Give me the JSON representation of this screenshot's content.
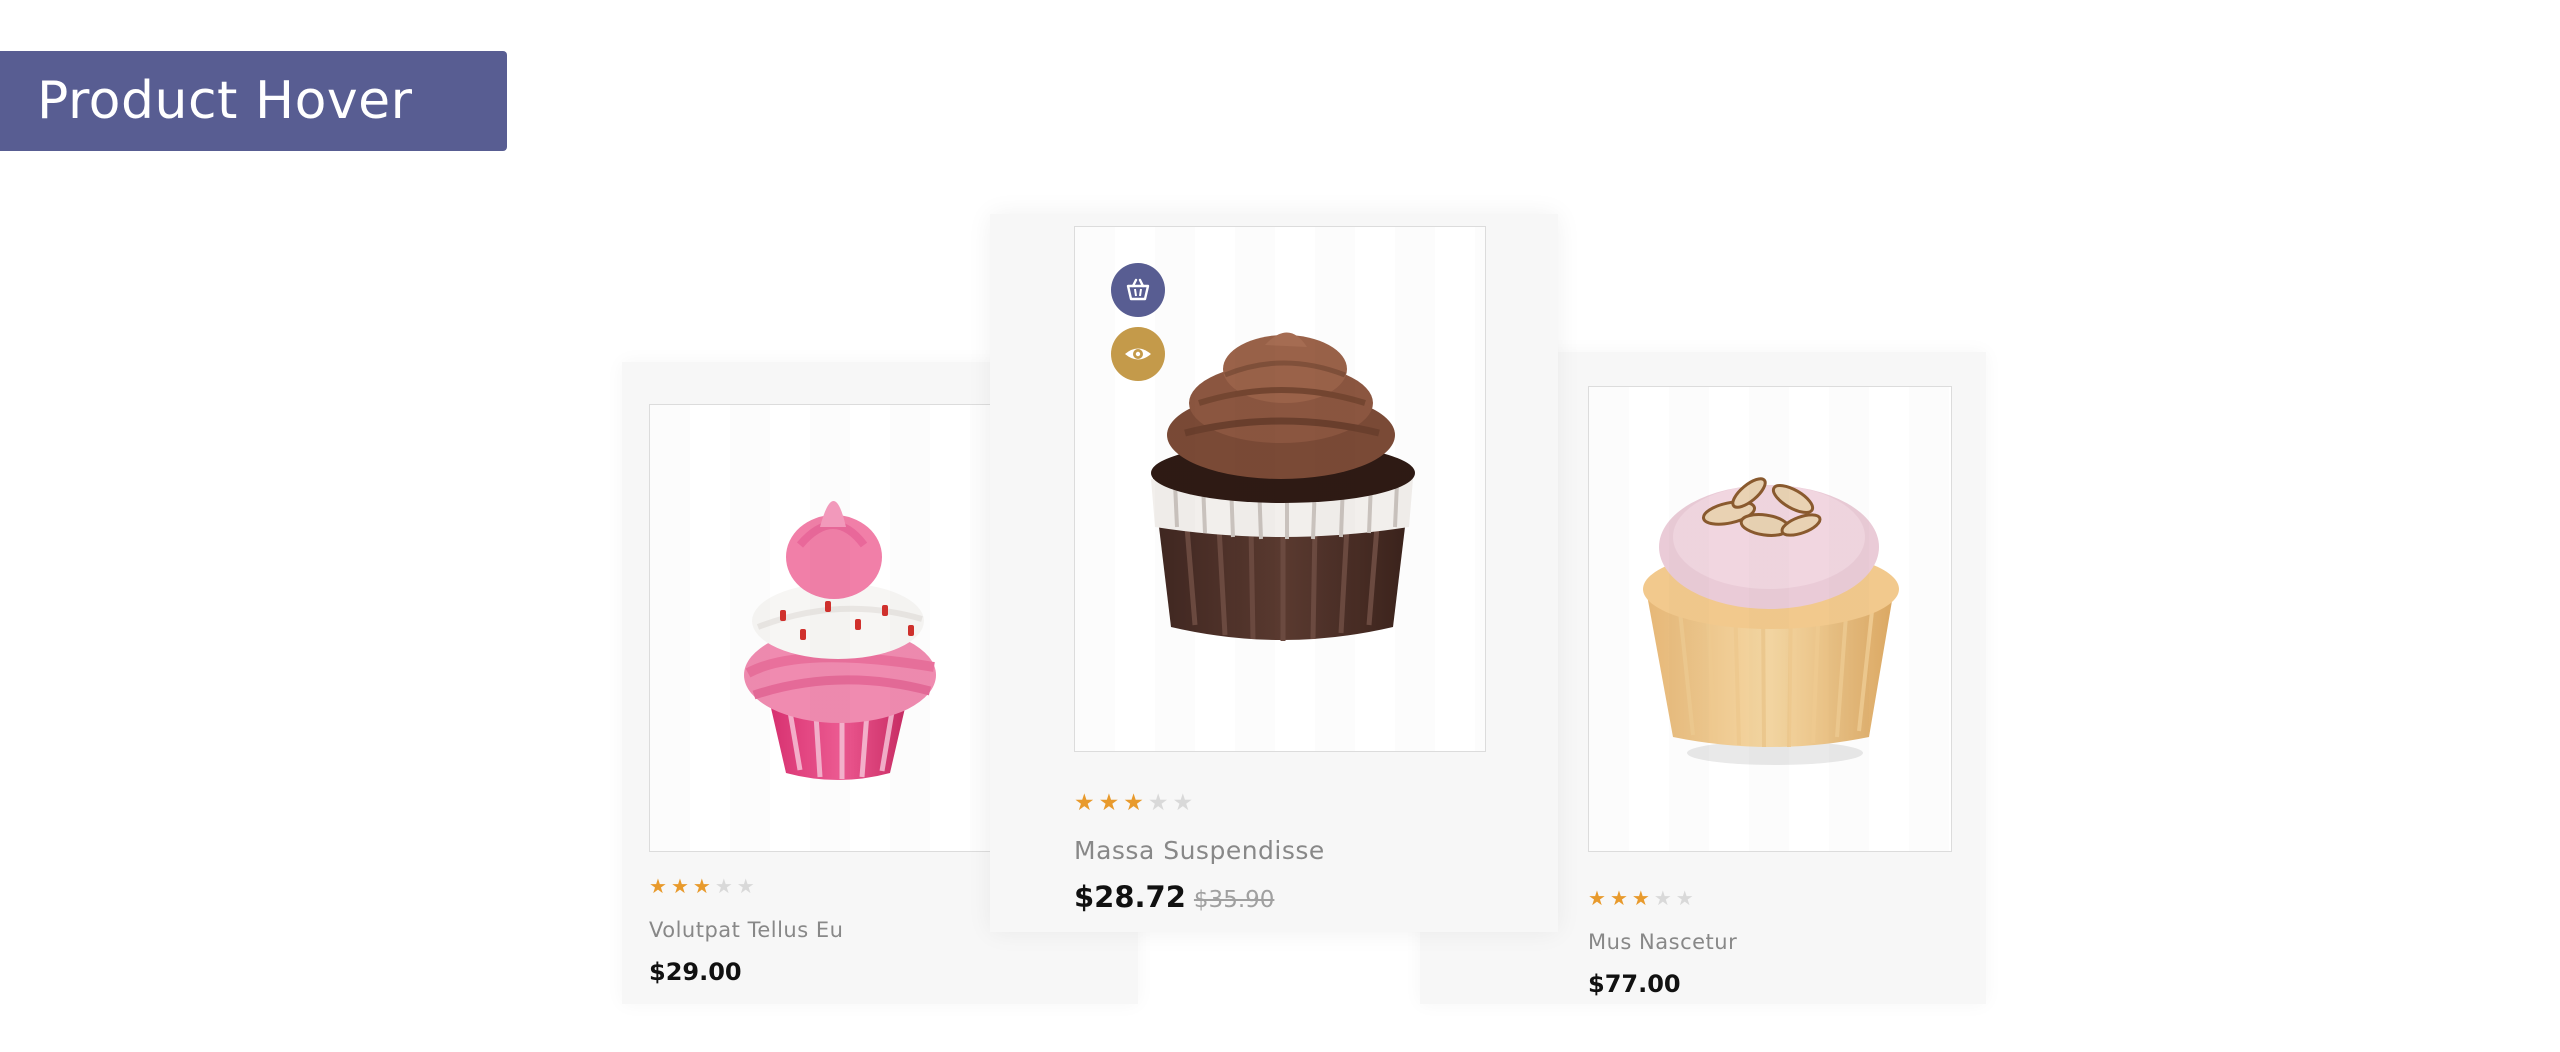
{
  "header": {
    "title": "Product Hover"
  },
  "products": [
    {
      "name": "Volutpat Tellus Eu",
      "price": "$29.00",
      "rating": 3,
      "max_rating": 5
    },
    {
      "name": "Massa Suspendisse",
      "price": "$28.72",
      "old_price": "$35.90",
      "rating": 3,
      "max_rating": 5,
      "actions": [
        {
          "icon": "basket-icon",
          "color": "#585d92"
        },
        {
          "icon": "eye-icon",
          "color": "#c49a4a"
        }
      ]
    },
    {
      "name": "Mus Nascetur",
      "price": "$77.00",
      "rating": 3,
      "max_rating": 5
    }
  ],
  "colors": {
    "accent": "#585d92",
    "gold": "#c49a4a",
    "star": "#e89a2c",
    "card_bg": "#f7f7f7"
  }
}
